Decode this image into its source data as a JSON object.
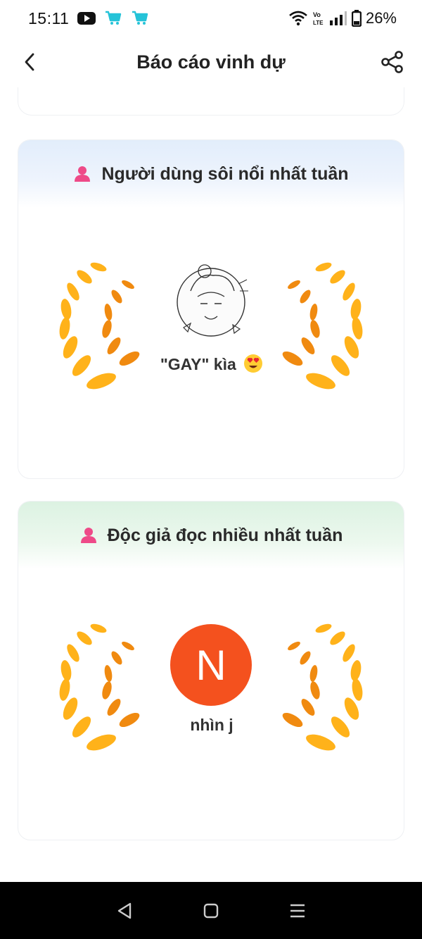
{
  "status_bar": {
    "time": "15:11",
    "battery": "26%",
    "icons": [
      "youtube-icon",
      "shop-icon",
      "shop-icon",
      "wifi-icon",
      "volte-icon",
      "signal-icon",
      "battery-icon"
    ]
  },
  "header": {
    "title": "Báo cáo vinh dự",
    "back_icon": "chevron-left-icon",
    "share_icon": "share-icon"
  },
  "cards": [
    {
      "title": "Người dùng sôi nổi nhất tuần",
      "user_name": "\"GAY\" kìa",
      "user_emoji": "😍",
      "avatar": "sketch-avatar",
      "header_color": "#e2edfb"
    },
    {
      "title": "Độc giả đọc nhiều nhất tuần",
      "user_name": "nhìn j",
      "avatar_letter": "N",
      "avatar_color": "#f4511e",
      "header_color": "#dcf2e2"
    }
  ],
  "nav_bar": {
    "icons": [
      "back-triangle-icon",
      "home-square-icon",
      "recents-menu-icon"
    ]
  }
}
